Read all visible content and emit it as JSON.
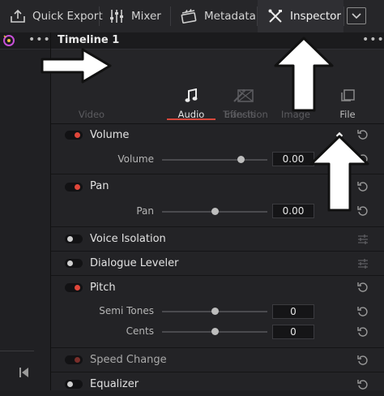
{
  "topbar": {
    "quick_export": "Quick Export",
    "mixer": "Mixer",
    "metadata": "Metadata",
    "inspector": "Inspector"
  },
  "timeline": {
    "title": "Timeline 1"
  },
  "tabs": [
    {
      "label": "Video",
      "active": false
    },
    {
      "label": "Audio",
      "active": true
    },
    {
      "label": "Effects",
      "active": false
    },
    {
      "label": "Transition",
      "active": false
    },
    {
      "label": "Image",
      "active": false
    },
    {
      "label": "File",
      "active": false
    }
  ],
  "sections": {
    "volume": {
      "title": "Volume",
      "param": "Volume",
      "value": "0.00",
      "slider": 0.75
    },
    "pan": {
      "title": "Pan",
      "param": "Pan",
      "value": "0.00",
      "slider": 0.5
    },
    "voice_isolation": {
      "title": "Voice Isolation"
    },
    "dialogue_leveler": {
      "title": "Dialogue Leveler"
    },
    "pitch": {
      "title": "Pitch",
      "semi_tones_label": "Semi Tones",
      "semi_tones_value": "0",
      "semi_tones_slider": 0.5,
      "cents_label": "Cents",
      "cents_value": "0",
      "cents_slider": 0.5
    },
    "speed_change": {
      "title": "Speed Change"
    },
    "equalizer": {
      "title": "Equalizer"
    }
  },
  "colors": {
    "accent": "#e0463a",
    "background": "#232326"
  }
}
